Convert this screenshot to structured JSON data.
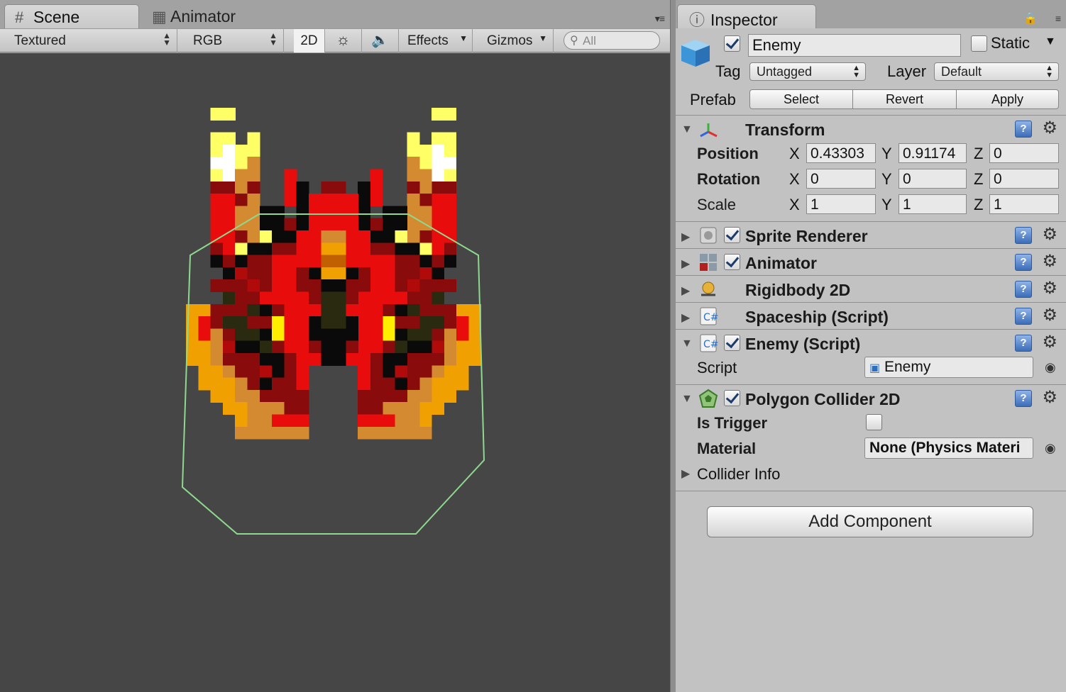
{
  "scene_tabs": [
    {
      "label": "Scene",
      "icon": "grid-icon"
    },
    {
      "label": "Animator",
      "icon": "animator-icon"
    }
  ],
  "scene_toolbar": {
    "draw_mode": "Textured",
    "render_mode": "RGB",
    "mode_2d": "2D",
    "effects": "Effects",
    "gizmos": "Gizmos",
    "search_placeholder": "All"
  },
  "inspector": {
    "tab_label": "Inspector",
    "object_name": "Enemy",
    "active": true,
    "static_label": "Static",
    "static": false,
    "tag_label": "Tag",
    "tag_value": "Untagged",
    "layer_label": "Layer",
    "layer_value": "Default",
    "prefab_label": "Prefab",
    "prefab_buttons": [
      "Select",
      "Revert",
      "Apply"
    ]
  },
  "transform": {
    "title": "Transform",
    "position_label": "Position",
    "rotation_label": "Rotation",
    "scale_label": "Scale",
    "position": {
      "x": "0.43303",
      "y": "0.91174",
      "z": "0"
    },
    "rotation": {
      "x": "0",
      "y": "0",
      "z": "0"
    },
    "scale": {
      "x": "1",
      "y": "1",
      "z": "1"
    },
    "axis_x": "X",
    "axis_y": "Y",
    "axis_z": "Z"
  },
  "components": [
    {
      "title": "Sprite Renderer",
      "enabled": true,
      "icon": "sprite-renderer-icon"
    },
    {
      "title": "Animator",
      "enabled": true,
      "icon": "animator-component-icon"
    },
    {
      "title": "Rigidbody 2D",
      "icon": "rigidbody2d-icon"
    },
    {
      "title": "Spaceship (Script)",
      "icon": "script-icon"
    },
    {
      "title": "Enemy (Script)",
      "enabled": true,
      "icon": "script-icon"
    },
    {
      "title": "Polygon Collider 2D",
      "enabled": true,
      "icon": "polygon-collider-icon"
    }
  ],
  "enemy_script": {
    "script_label": "Script",
    "script_value": "Enemy"
  },
  "polygon_collider": {
    "is_trigger_label": "Is Trigger",
    "is_trigger": false,
    "material_label": "Material",
    "material_value": "None (Physics Materi",
    "collider_info_label": "Collider Info"
  },
  "add_component_label": "Add Component",
  "colors": {
    "scene_background": "#464646",
    "collider_outline": "#8fd98f",
    "sprite_red": "#e80c0c",
    "sprite_dark_red": "#8a0b0b",
    "sprite_orange": "#f0a000",
    "sprite_yellow": "#ffff66"
  }
}
